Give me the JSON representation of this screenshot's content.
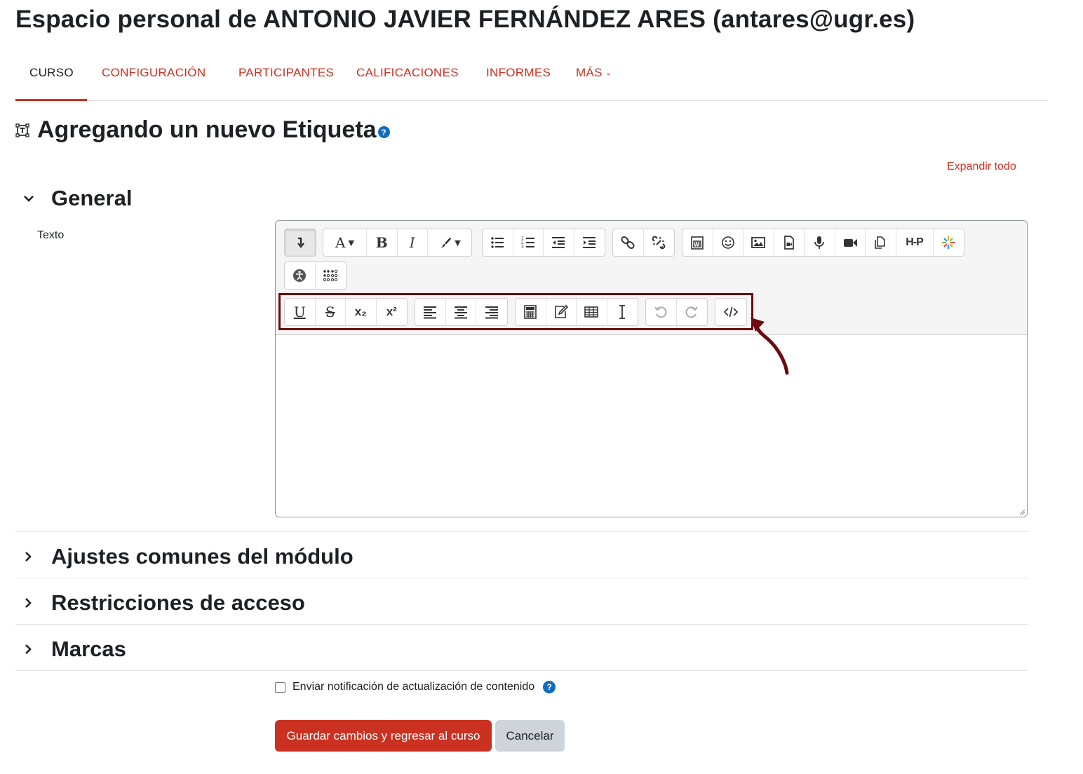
{
  "page": {
    "heading": "Espacio personal de ANTONIO JAVIER FERNÁNDEZ ARES (antares@ugr.es)"
  },
  "nav": {
    "items": [
      {
        "label": "CURSO",
        "active": true
      },
      {
        "label": "CONFIGURACIÓN"
      },
      {
        "label": "PARTICIPANTES"
      },
      {
        "label": "CALIFICACIONES"
      },
      {
        "label": "INFORMES"
      },
      {
        "label": "MÁS"
      }
    ]
  },
  "form": {
    "title": "Agregando un nuevo Etiqueta",
    "expand_all": "Expandir todo",
    "sections": {
      "general": "General",
      "common": "Ajustes comunes del módulo",
      "restrictions": "Restricciones de acceso",
      "tags": "Marcas"
    },
    "text_label": "Texto",
    "editor_value": "",
    "notification_label": "Enviar notificación de actualización de contenido",
    "notification_checked": false,
    "save_button": "Guardar cambios y regresar al curso",
    "cancel_button": "Cancelar"
  },
  "toolbar": {
    "row1": [
      [
        "show-more-buttons-icon"
      ],
      [
        "font-size-icon",
        "bold-icon",
        "italic-icon",
        "font-color-icon"
      ],
      [
        "unordered-list-icon",
        "ordered-list-icon",
        "outdent-icon",
        "indent-icon"
      ],
      [
        "link-icon",
        "unlink-icon"
      ],
      [
        "word-paste-icon",
        "emoji-icon",
        "image-icon",
        "media-icon",
        "record-audio-icon",
        "record-video-icon",
        "manage-files-icon",
        "h5p-icon",
        "kaltura-icon"
      ]
    ],
    "row2": [
      [
        "accessibility-checker-icon",
        "braille-icon"
      ]
    ],
    "row3": [
      [
        "underline-icon",
        "strikethrough-icon",
        "subscript-icon",
        "superscript-icon"
      ],
      [
        "align-left-icon",
        "align-center-icon",
        "align-right-icon"
      ],
      [
        "equation-icon",
        "edit-table-icon",
        "table-icon",
        "character-map-icon"
      ],
      [
        "undo-icon",
        "redo-icon"
      ],
      [
        "html-source-icon"
      ]
    ],
    "labels": {
      "bold": "B",
      "italic": "I",
      "underline": "U",
      "strike": "S",
      "sub": "x₂",
      "sup": "x²",
      "font": "A",
      "h5p": "H-P"
    }
  },
  "colors": {
    "accent": "#ca3120",
    "annotation": "#6b0b0f",
    "help": "#0f6cbf"
  }
}
